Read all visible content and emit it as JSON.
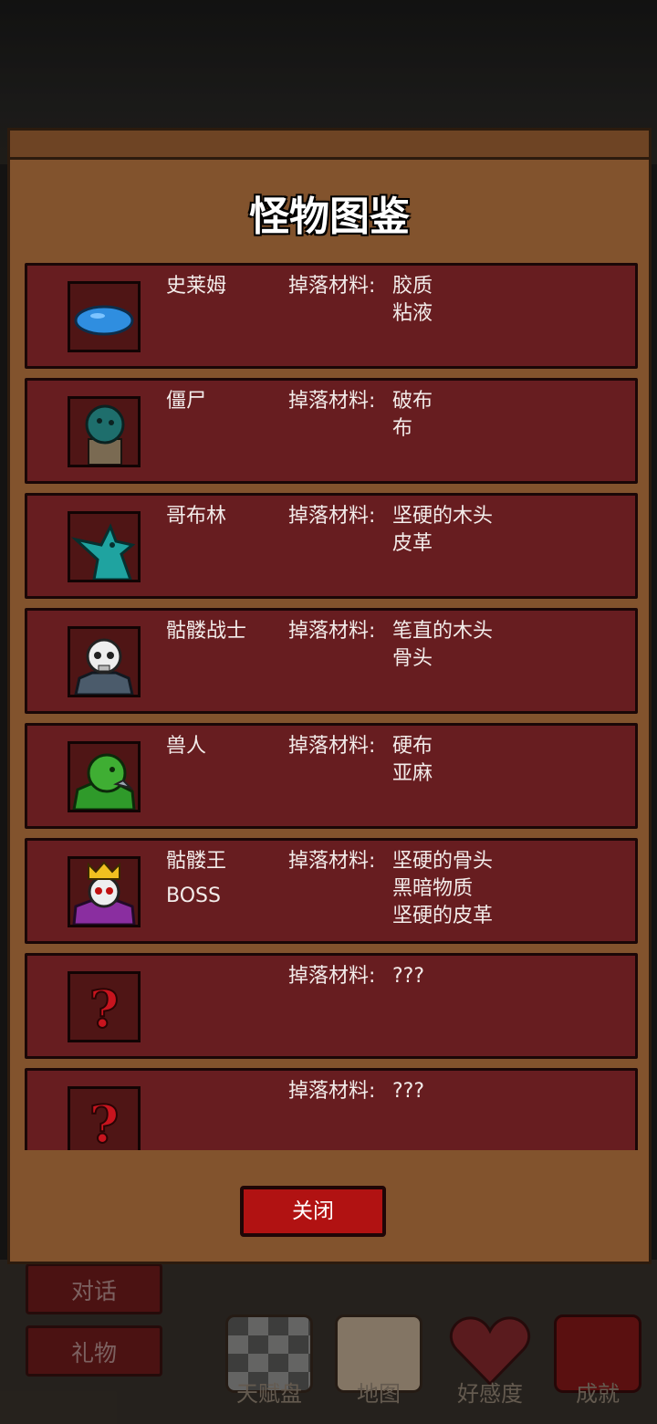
{
  "dialog": {
    "title": "怪物图鉴",
    "close_label": "关闭"
  },
  "monsters": [
    {
      "name": "史莱姆",
      "drop_label": "掉落材料:",
      "drops": [
        "胶质",
        "粘液"
      ],
      "icon": "slime-icon"
    },
    {
      "name": "僵尸",
      "drop_label": "掉落材料:",
      "drops": [
        "破布",
        "布"
      ],
      "icon": "zombie-icon"
    },
    {
      "name": "哥布林",
      "drop_label": "掉落材料:",
      "drops": [
        "坚硬的木头",
        "皮革"
      ],
      "icon": "goblin-icon"
    },
    {
      "name": "骷髅战士",
      "drop_label": "掉落材料:",
      "drops": [
        "笔直的木头",
        "骨头"
      ],
      "icon": "skeleton-warrior-icon"
    },
    {
      "name": "兽人",
      "drop_label": "掉落材料:",
      "drops": [
        "硬布",
        "亚麻"
      ],
      "icon": "orc-icon"
    },
    {
      "name": "骷髅王",
      "tag": "BOSS",
      "drop_label": "掉落材料:",
      "drops": [
        "坚硬的骨头",
        "黑暗物质",
        "坚硬的皮革"
      ],
      "icon": "skeleton-king-icon"
    },
    {
      "name": "",
      "drop_label": "掉落材料:",
      "drops": [
        "???"
      ],
      "icon": "unknown-icon"
    },
    {
      "name": "",
      "drop_label": "掉落材料:",
      "drops": [
        "???"
      ],
      "icon": "unknown-icon"
    }
  ],
  "side_buttons": [
    {
      "label": "对话"
    },
    {
      "label": "礼物"
    }
  ],
  "bottom_nav": [
    {
      "label": "天赋盘",
      "icon": "talent-board-icon"
    },
    {
      "label": "地图",
      "icon": "map-icon"
    },
    {
      "label": "好感度",
      "icon": "heart-icon"
    },
    {
      "label": "成就",
      "icon": "achievement-icon"
    }
  ],
  "colors": {
    "row_bg": "#671d20",
    "panel_bg": "#82532d",
    "button_red": "#b11212"
  }
}
